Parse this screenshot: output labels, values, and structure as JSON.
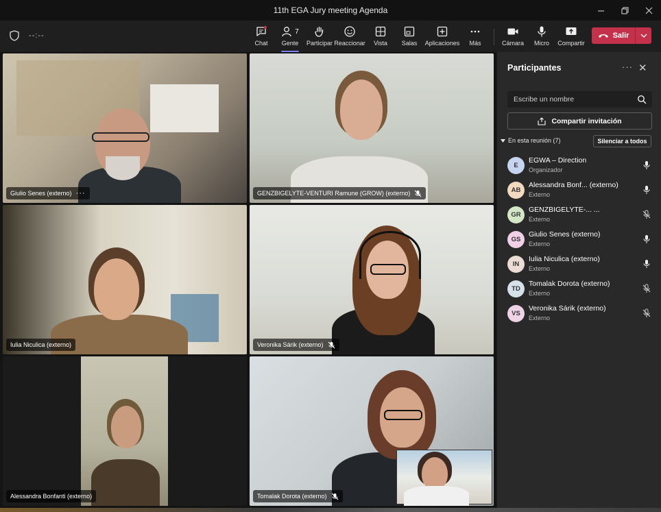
{
  "window": {
    "title": "11th EGA Jury meeting Agenda",
    "controls": [
      "minimize-icon",
      "restore-icon",
      "close-icon"
    ]
  },
  "toolbar": {
    "timer": "--:--",
    "chat": "Chat",
    "people": "Gente",
    "people_count": "7",
    "raise": "Participar",
    "react": "Reaccionar",
    "view": "Vista",
    "rooms": "Salas",
    "apps": "Aplicaciones",
    "more": "Más",
    "camera": "Cámara",
    "mic": "Micro",
    "share": "Compartir",
    "leave": "Salir"
  },
  "tiles": [
    {
      "name": "Giulio Senes (externo)",
      "muted": false,
      "more": "···"
    },
    {
      "name": "GENZBIGELYTE-VENTURI Ramune (GROW) (externo)",
      "muted": true
    },
    {
      "name": "Iulia Niculica (externo)",
      "muted": false
    },
    {
      "name": "Veronika Sárik (externo)",
      "muted": true
    },
    {
      "name": "Alessandra Bonfanti (externo)",
      "muted": false
    },
    {
      "name": "Tomalak Dorota (externo)",
      "muted": true
    }
  ],
  "panel": {
    "title": "Participantes",
    "more": "···",
    "search_placeholder": "Escribe un nombre",
    "invite": "Compartir invitación",
    "section": "En esta reunión (7)",
    "mute_all": "Silenciar a todos",
    "participants": [
      {
        "initials": "E",
        "name": "EGWA – Direction",
        "role": "Organizador",
        "color": "#c7d4f0",
        "muted": false
      },
      {
        "initials": "AB",
        "name": "Alessandra Bonf...  (externo)",
        "role": "Externo",
        "color": "#f4d9c1",
        "muted": false
      },
      {
        "initials": "GR",
        "name": "GENZBIGELYTE-...  ...",
        "role": "Externo",
        "color": "#d3e7c6",
        "muted": true
      },
      {
        "initials": "GS",
        "name": "Giulio Senes (externo)",
        "role": "Externo",
        "color": "#f1cfe6",
        "muted": false
      },
      {
        "initials": "IN",
        "name": "Iulia Niculica (externo)",
        "role": "Externo",
        "color": "#ecdcd6",
        "muted": false
      },
      {
        "initials": "TD",
        "name": "Tomalak Dorota (externo)",
        "role": "Externo",
        "color": "#d6e2ea",
        "muted": true
      },
      {
        "initials": "VS",
        "name": "Veronika Sárik (externo)",
        "role": "Externo",
        "color": "#eed3e6",
        "muted": true
      }
    ]
  }
}
